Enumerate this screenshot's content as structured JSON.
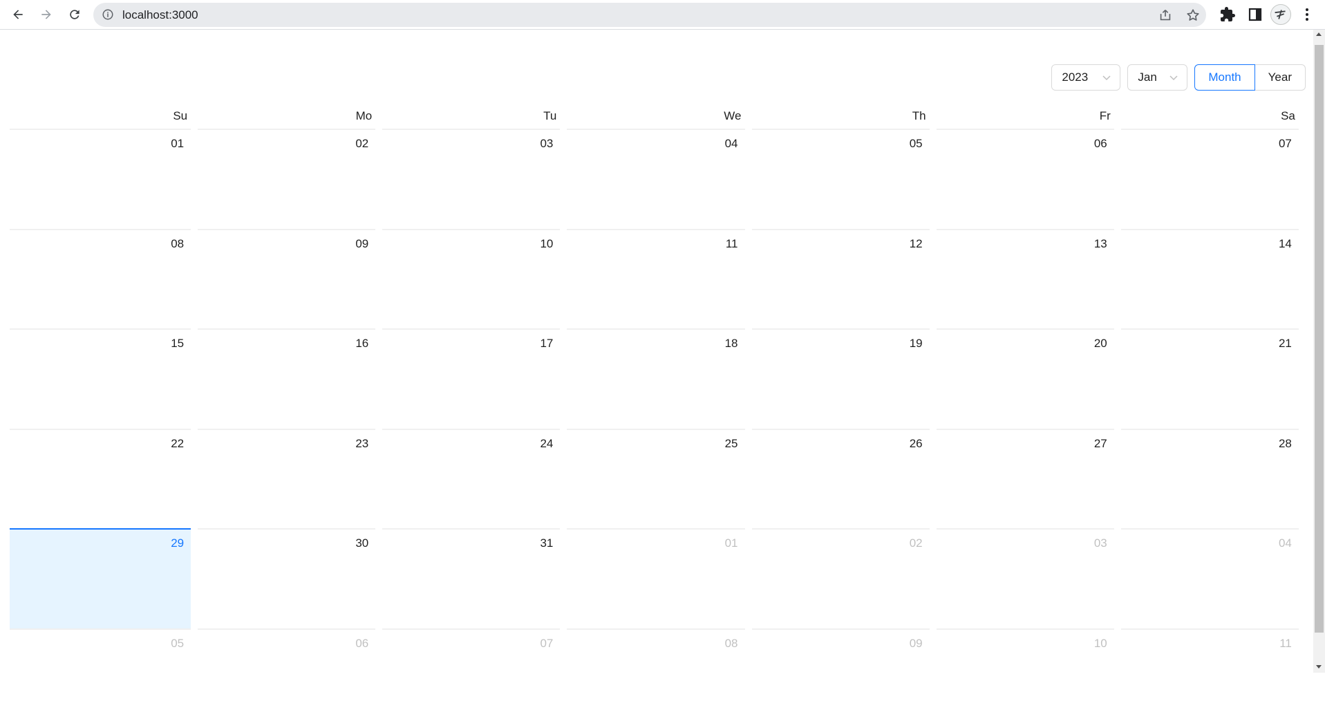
{
  "browser": {
    "url": "localhost:3000",
    "icons": [
      "back-arrow-icon",
      "forward-arrow-icon",
      "reload-icon",
      "info-icon",
      "share-icon",
      "star-icon",
      "puzzle-icon",
      "side-panel-icon",
      "more-vertical-icon"
    ]
  },
  "calendar": {
    "year_select": "2023",
    "month_select": "Jan",
    "mode_month_label": "Month",
    "mode_year_label": "Year",
    "active_mode": "Month",
    "weekdays": [
      "Su",
      "Mo",
      "Tu",
      "We",
      "Th",
      "Fr",
      "Sa"
    ],
    "weeks": [
      [
        {
          "d": "01"
        },
        {
          "d": "02"
        },
        {
          "d": "03"
        },
        {
          "d": "04"
        },
        {
          "d": "05"
        },
        {
          "d": "06"
        },
        {
          "d": "07"
        }
      ],
      [
        {
          "d": "08"
        },
        {
          "d": "09"
        },
        {
          "d": "10"
        },
        {
          "d": "11"
        },
        {
          "d": "12"
        },
        {
          "d": "13"
        },
        {
          "d": "14"
        }
      ],
      [
        {
          "d": "15"
        },
        {
          "d": "16"
        },
        {
          "d": "17"
        },
        {
          "d": "18"
        },
        {
          "d": "19"
        },
        {
          "d": "20"
        },
        {
          "d": "21"
        }
      ],
      [
        {
          "d": "22"
        },
        {
          "d": "23"
        },
        {
          "d": "24"
        },
        {
          "d": "25"
        },
        {
          "d": "26"
        },
        {
          "d": "27"
        },
        {
          "d": "28"
        }
      ],
      [
        {
          "d": "29",
          "today": true
        },
        {
          "d": "30"
        },
        {
          "d": "31"
        },
        {
          "d": "01",
          "other": true
        },
        {
          "d": "02",
          "other": true
        },
        {
          "d": "03",
          "other": true
        },
        {
          "d": "04",
          "other": true
        }
      ],
      [
        {
          "d": "05",
          "other": true
        },
        {
          "d": "06",
          "other": true
        },
        {
          "d": "07",
          "other": true
        },
        {
          "d": "08",
          "other": true
        },
        {
          "d": "09",
          "other": true
        },
        {
          "d": "10",
          "other": true
        },
        {
          "d": "11",
          "other": true
        }
      ]
    ],
    "colors": {
      "primary": "#1677ff",
      "today_bg": "#e6f4ff",
      "muted_text": "rgba(0,0,0,0.25)"
    }
  }
}
